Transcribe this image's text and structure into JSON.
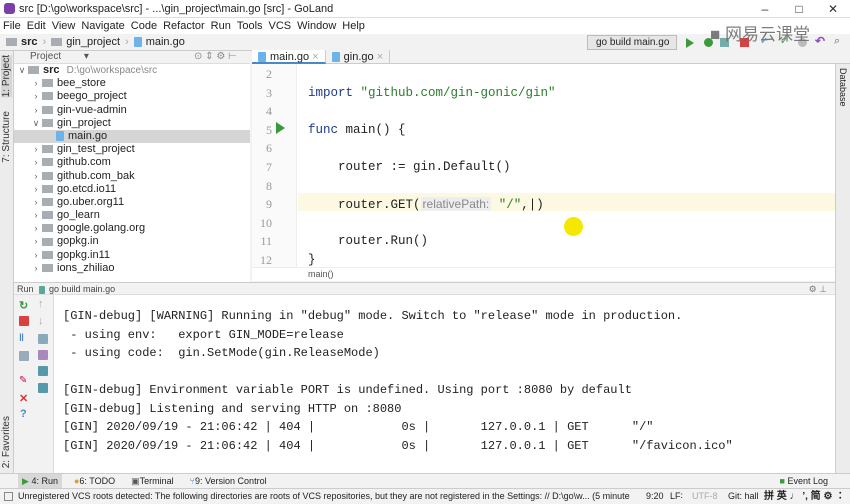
{
  "window": {
    "title": "src [D:\\go\\workspace\\src] - ...\\gin_project\\main.go [src] - GoLand",
    "minimize": "–",
    "maximize": "□",
    "close": "✕"
  },
  "menu": [
    "File",
    "Edit",
    "View",
    "Navigate",
    "Code",
    "Refactor",
    "Run",
    "Tools",
    "VCS",
    "Window",
    "Help"
  ],
  "navbar": {
    "crumbs": [
      "src",
      "gin_project",
      "main.go"
    ]
  },
  "toolbar": {
    "run_config": "go build main.go ∨",
    "icons": [
      "run-icon",
      "debug-icon",
      "coverage-icon",
      "stop-icon",
      "vcs-update-icon",
      "vcs-commit-icon",
      "history-icon",
      "revert-icon",
      "search-icon"
    ],
    "colors": {
      "run": "#3b9a3b",
      "stop": "#d94040"
    }
  },
  "watermark": "网易云课堂",
  "left_strip": {
    "tabs": [
      "1: Project",
      "7: Structure",
      "2: Favorites"
    ]
  },
  "project": {
    "header": "Project",
    "root": {
      "name": "src",
      "path": "D:\\go\\workspace\\src"
    },
    "items": [
      {
        "name": "bee_store",
        "type": "folder",
        "expanded": false,
        "depth": 1
      },
      {
        "name": "beego_project",
        "type": "folder",
        "expanded": false,
        "depth": 1
      },
      {
        "name": "gin-vue-admin",
        "type": "folder",
        "expanded": false,
        "depth": 1
      },
      {
        "name": "gin_project",
        "type": "folder",
        "expanded": true,
        "depth": 1
      },
      {
        "name": "main.go",
        "type": "file",
        "depth": 2,
        "selected": true
      },
      {
        "name": "gin_test_project",
        "type": "folder",
        "expanded": false,
        "depth": 1
      },
      {
        "name": "github.com",
        "type": "folder",
        "expanded": false,
        "depth": 1
      },
      {
        "name": "github.com_bak",
        "type": "folder",
        "expanded": false,
        "depth": 1
      },
      {
        "name": "go.etcd.io11",
        "type": "folder",
        "expanded": false,
        "depth": 1
      },
      {
        "name": "go.uber.org11",
        "type": "folder",
        "expanded": false,
        "depth": 1
      },
      {
        "name": "go_learn",
        "type": "folder",
        "expanded": false,
        "depth": 1
      },
      {
        "name": "google.golang.org",
        "type": "folder",
        "expanded": false,
        "depth": 1
      },
      {
        "name": "gopkg.in",
        "type": "folder",
        "expanded": false,
        "depth": 1
      },
      {
        "name": "gopkg.in11",
        "type": "folder",
        "expanded": false,
        "depth": 1
      },
      {
        "name": "ions_zhiliao",
        "type": "folder",
        "expanded": false,
        "depth": 1
      }
    ]
  },
  "editor": {
    "tabs": [
      {
        "label": "main.go",
        "active": true
      },
      {
        "label": "gin.go",
        "active": false
      }
    ],
    "lines": [
      {
        "n": "2",
        "parts": []
      },
      {
        "n": "3",
        "parts": [
          {
            "t": "import ",
            "c": "kw"
          },
          {
            "t": "\"github.com/gin-gonic/gin\"",
            "c": "str"
          }
        ]
      },
      {
        "n": "4",
        "parts": []
      },
      {
        "n": "5",
        "parts": [
          {
            "t": "func ",
            "c": "kw"
          },
          {
            "t": "main() {",
            "c": ""
          }
        ]
      },
      {
        "n": "6",
        "parts": []
      },
      {
        "n": "7",
        "parts": [
          {
            "t": "    router := gin.Default()",
            "c": ""
          }
        ]
      },
      {
        "n": "8",
        "parts": []
      },
      {
        "n": "9",
        "parts": [
          {
            "t": "    router.GET(",
            "c": ""
          },
          {
            "t": "relativePath:",
            "c": "hint"
          },
          {
            "t": " \"/\"",
            "c": "str"
          },
          {
            "t": ",|)",
            "c": ""
          }
        ]
      },
      {
        "n": "10",
        "parts": []
      },
      {
        "n": "11",
        "parts": [
          {
            "t": "    router.Run()",
            "c": ""
          }
        ]
      },
      {
        "n": "12",
        "parts": [
          {
            "t": "}",
            "c": ""
          }
        ]
      }
    ],
    "breadcrumb": "main()"
  },
  "right_strip": {
    "tabs": [
      "Database"
    ]
  },
  "run": {
    "label": "Run",
    "config": "go build main.go",
    "output": [
      "[GIN-debug] [WARNING] Running in \"debug\" mode. Switch to \"release\" mode in production.",
      " - using env:   export GIN_MODE=release",
      " - using code:  gin.SetMode(gin.ReleaseMode)",
      "",
      "[GIN-debug] Environment variable PORT is undefined. Using port :8080 by default",
      "[GIN-debug] Listening and serving HTTP on :8080",
      "[GIN] 2020/09/19 - 21:06:42 | 404 |            0s |       127.0.0.1 | GET      \"/\"",
      "[GIN] 2020/09/19 - 21:06:42 | 404 |            0s |       127.0.0.1 | GET      \"/favicon.ico\""
    ]
  },
  "bottom_tabs": [
    {
      "label": "4: Run",
      "active": true
    },
    {
      "label": "6: TODO"
    },
    {
      "label": "Terminal"
    },
    {
      "label": "9: Version Control"
    }
  ],
  "event_log": "Event Log",
  "status": {
    "message": "Unregistered VCS roots detected: The following directories are roots of VCS repositories, but they are not registered in the Settings: // D:\\go\\w... (5 minutes ago)",
    "position": "9:20",
    "line_sep": "LF∶",
    "encoding": "UTF-8",
    "git": "Git: hall",
    "ime": "拼 英 ♩ ’, 简 ⚙ ∶"
  }
}
